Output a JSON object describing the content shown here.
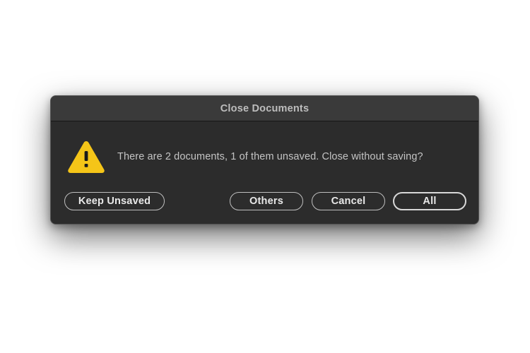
{
  "dialog": {
    "title": "Close Documents",
    "icon": "warning-icon",
    "icon_color": "#f5c518",
    "message": "There are 2 documents, 1 of them unsaved. Close without saving?",
    "buttons": {
      "keep_unsaved": "Keep Unsaved",
      "others": "Others",
      "cancel": "Cancel",
      "all": "All"
    }
  },
  "colors": {
    "dialog_bg": "#2c2c2c",
    "titlebar_bg": "#3a3a3a",
    "text": "#c4c4c4",
    "button_text": "#e8e8e8"
  }
}
